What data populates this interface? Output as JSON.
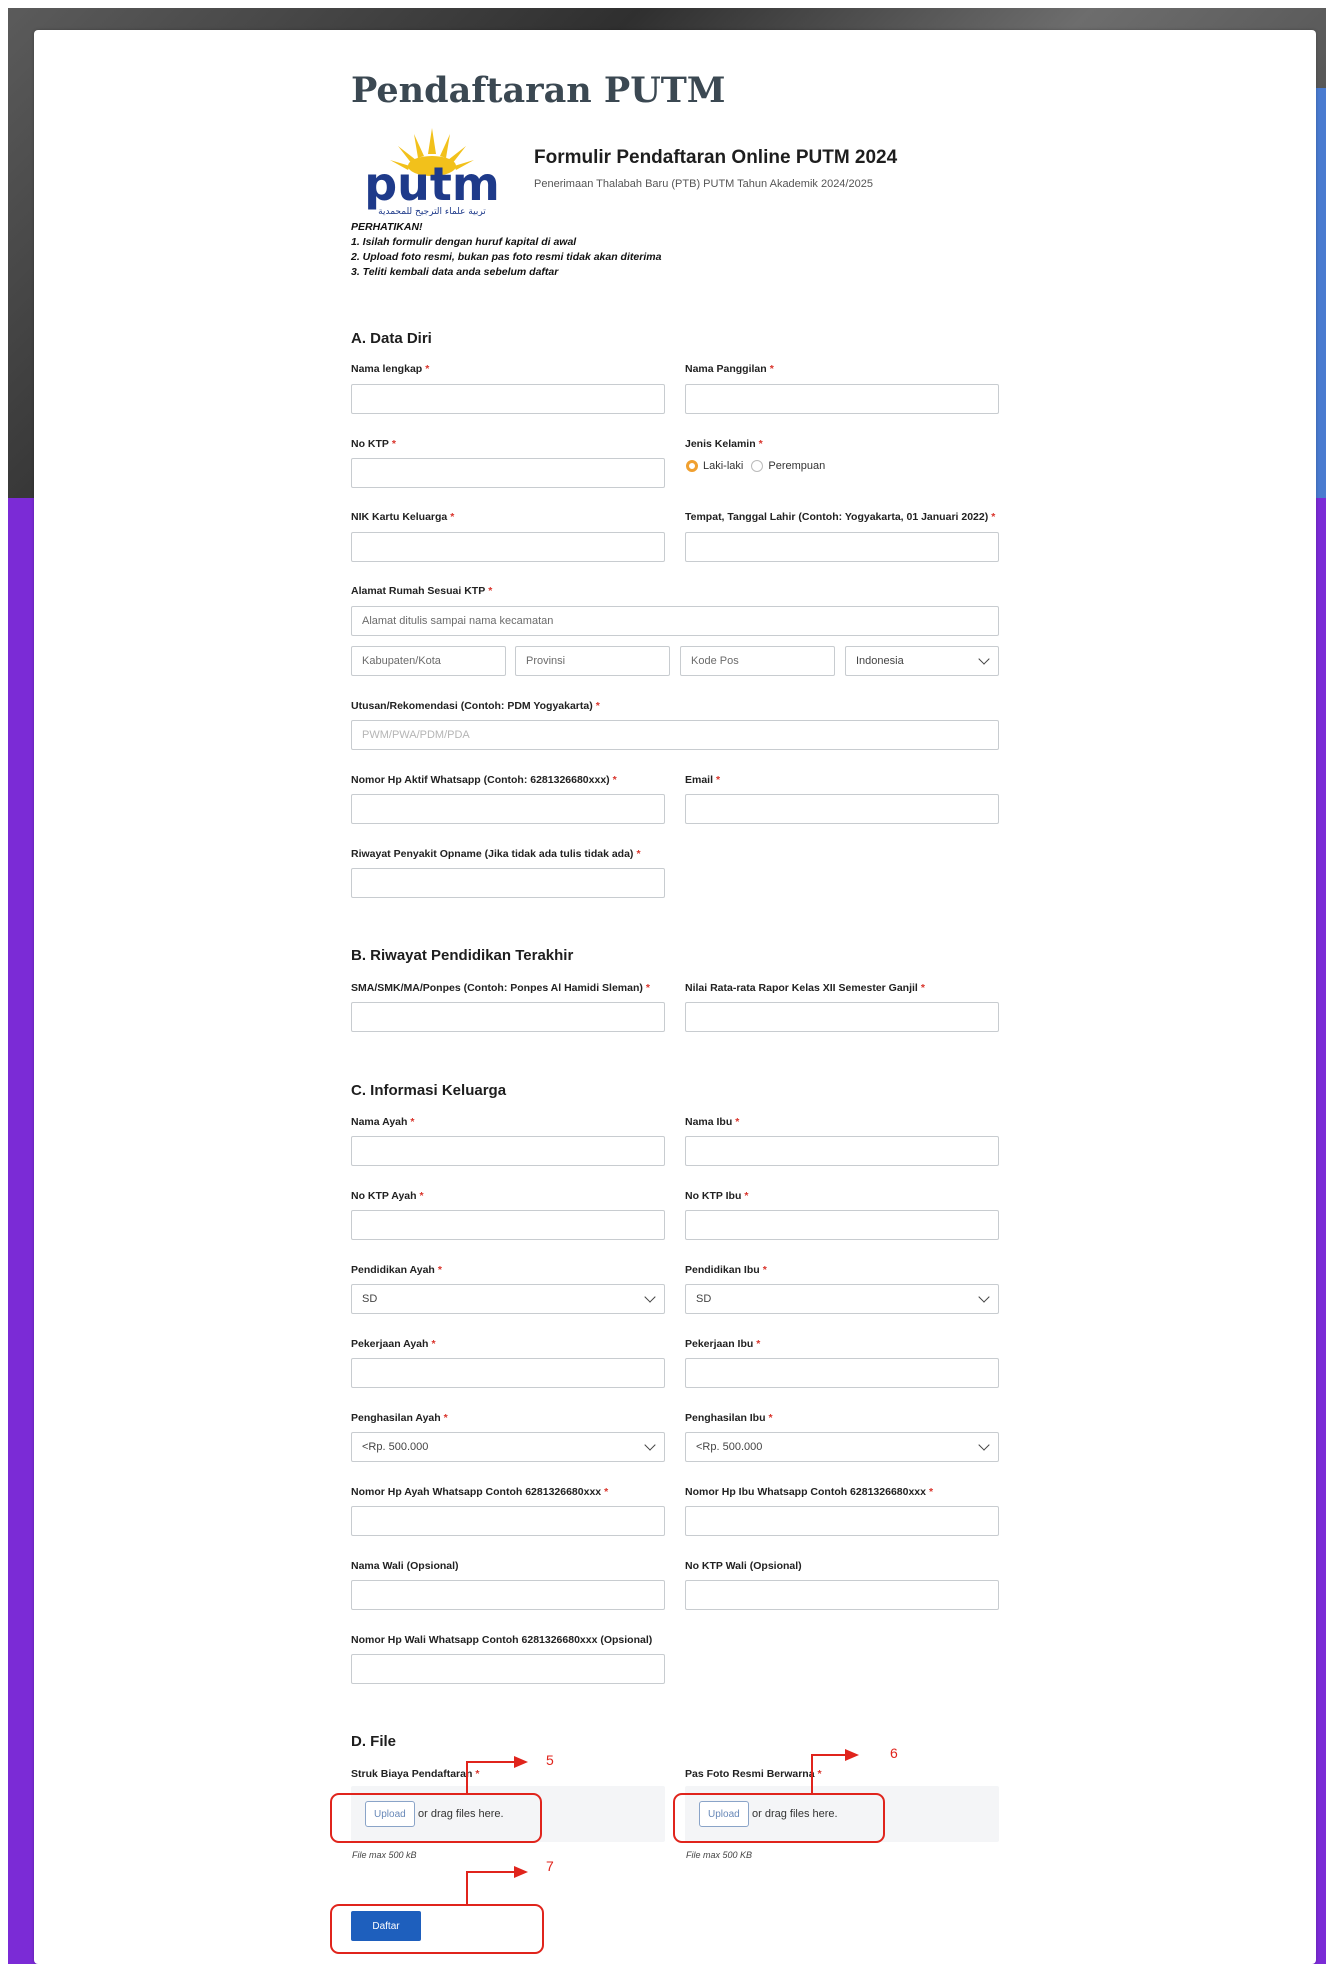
{
  "page_title": "Pendaftaran PUTM",
  "header": {
    "form_title": "Formulir Pendaftaran Online PUTM 2024",
    "form_subtitle": "Penerimaan Thalabah Baru (PTB) PUTM Tahun Akademik 2024/2025",
    "logo_text": "putm",
    "logo_arabic": "تربية علماء الترجيح للمحمدية"
  },
  "notice": {
    "title": "PERHATIKAN!",
    "lines": [
      "1. Isilah formulir dengan huruf kapital di awal",
      "2. Upload foto resmi, bukan pas foto resmi tidak akan diterima",
      "3. Teliti kembali data anda sebelum daftar"
    ]
  },
  "sections": {
    "a": "A. Data Diri",
    "b": "B. Riwayat Pendidikan Terakhir",
    "c": "C. Informasi Keluarga",
    "d": "D. File"
  },
  "required_marker": "*",
  "fields": {
    "nama_lengkap": "Nama lengkap",
    "nama_panggilan": "Nama Panggilan",
    "no_ktp": "No KTP",
    "jenis_kelamin": "Jenis Kelamin",
    "gender_options": [
      "Laki-laki",
      "Perempuan"
    ],
    "nik_kk": "NIK Kartu Keluarga",
    "ttl": "Tempat, Tanggal Lahir (Contoh: Yogyakarta, 01 Januari 2022)",
    "alamat": "Alamat Rumah Sesuai KTP",
    "alamat_placeholder": "Alamat ditulis sampai nama kecamatan",
    "kabupaten_placeholder": "Kabupaten/Kota",
    "provinsi_placeholder": "Provinsi",
    "kodepos_placeholder": "Kode Pos",
    "country_value": "Indonesia",
    "utusan": "Utusan/Rekomendasi (Contoh: PDM Yogyakarta)",
    "utusan_placeholder": "PWM/PWA/PDM/PDA",
    "nomor_hp": "Nomor Hp Aktif Whatsapp (Contoh: 6281326680xxx)",
    "email": "Email",
    "riwayat_penyakit": "Riwayat Penyakit Opname (Jika tidak ada tulis tidak ada)",
    "sekolah": "SMA/SMK/MA/Ponpes (Contoh: Ponpes Al Hamidi Sleman)",
    "nilai_rapor": "Nilai Rata-rata Rapor Kelas XII Semester Ganjil",
    "nama_ayah": "Nama Ayah",
    "nama_ibu": "Nama Ibu",
    "ktp_ayah": "No KTP Ayah",
    "ktp_ibu": "No KTP Ibu",
    "pendidikan_ayah": "Pendidikan Ayah",
    "pendidikan_ibu": "Pendidikan Ibu",
    "pendidikan_ayah_value": "SD",
    "pendidikan_ibu_value": "SD",
    "pekerjaan_ayah": "Pekerjaan Ayah",
    "pekerjaan_ibu": "Pekerjaan Ibu",
    "penghasilan_ayah": "Penghasilan Ayah",
    "penghasilan_ibu": "Penghasilan Ibu",
    "penghasilan_ayah_value": "<Rp. 500.000",
    "penghasilan_ibu_value": "<Rp. 500.000",
    "hp_ayah": "Nomor Hp Ayah Whatsapp Contoh 6281326680xxx",
    "hp_ibu": "Nomor Hp Ibu Whatsapp Contoh 6281326680xxx",
    "nama_wali": "Nama Wali (Opsional)",
    "ktp_wali": "No KTP Wali (Opsional)",
    "hp_wali": "Nomor Hp Wali Whatsapp Contoh 6281326680xxx (Opsional)",
    "struk": "Struk Biaya Pendaftaran",
    "pas_foto": "Pas Foto Resmi Berwarna"
  },
  "upload": {
    "button": "Upload",
    "text": "or drag files here.",
    "note_struk": "File max 500 kB",
    "note_foto": "File max 500 KB"
  },
  "submit_label": "Daftar",
  "annotations": [
    "5",
    "6",
    "7"
  ],
  "colors": {
    "accent_purple": "#7b2bd6",
    "button_blue": "#1e5fbd",
    "radio_selected": "#f0a030",
    "required_red": "#d9342b",
    "annotation_red": "#e0241c"
  }
}
